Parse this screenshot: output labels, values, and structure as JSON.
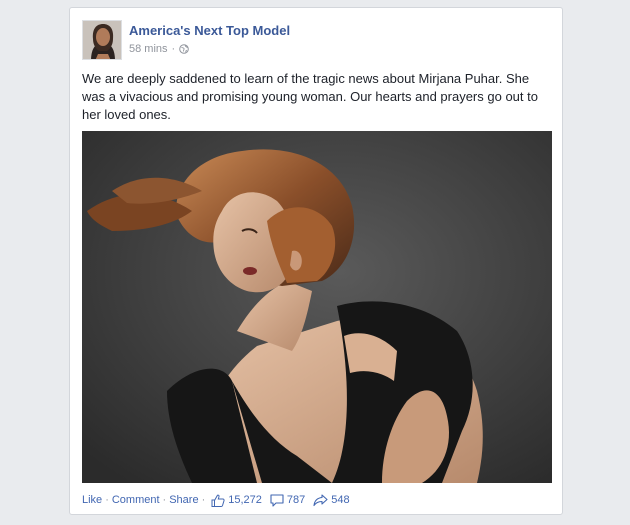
{
  "post": {
    "page_name": "America's Next Top Model",
    "timestamp": "58 mins",
    "privacy_icon": "globe-icon",
    "text": "We are deeply saddened to learn of the tragic news about Mirjana Puhar. She was a vivacious and promising young woman. Our hearts and prayers go out to her loved ones.",
    "photo": {
      "subject": "studio portrait of a woman with short windswept auburn hair in a black top against a dark gray background"
    }
  },
  "actions": {
    "like_label": "Like",
    "comment_label": "Comment",
    "share_label": "Share",
    "separator": "·"
  },
  "stats": {
    "likes": "15,272",
    "comments": "787",
    "shares": "548",
    "like_icon": "thumbs-up-icon",
    "comment_icon": "comment-bubble-icon",
    "share_icon": "share-arrow-icon"
  },
  "colors": {
    "background": "#e9ebee",
    "card": "#ffffff",
    "link": "#3b5998",
    "action_link": "#4267b2",
    "muted": "#90949c",
    "text": "#1d2129"
  }
}
